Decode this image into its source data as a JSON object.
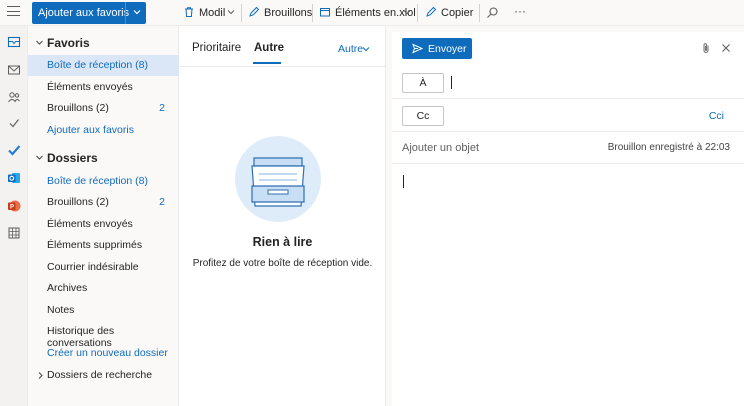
{
  "toolbar": {
    "favorites_button": "Ajouter aux favoris",
    "modify": "Modil",
    "drafts": "Brouillons",
    "sent_items": "Éléments en.xlol",
    "copy": "Copier",
    "more": "···"
  },
  "favorites": {
    "title": "Favoris",
    "items": [
      {
        "label": "Boîte de réception (8)",
        "count": ""
      },
      {
        "label": "Éléments envoyés",
        "count": ""
      },
      {
        "label": "Brouillons (2)",
        "count": "2"
      },
      {
        "label": "Ajouter aux favoris",
        "count": ""
      }
    ]
  },
  "folders": {
    "title": "Dossiers",
    "items": [
      {
        "label": "Boîte de réception (8)",
        "count": ""
      },
      {
        "label": "Brouillons (2)",
        "count": "2"
      },
      {
        "label": "Éléments envoyés",
        "count": ""
      },
      {
        "label": "Éléments supprimés",
        "count": ""
      },
      {
        "label": "Courrier indésirable",
        "count": ""
      },
      {
        "label": "Archives",
        "count": ""
      },
      {
        "label": "Notes",
        "count": ""
      },
      {
        "label": "Historique des conversations",
        "count": ""
      },
      {
        "label": "Créer un nouveau dossier",
        "count": ""
      },
      {
        "label": "Dossiers de recherche",
        "count": ""
      }
    ]
  },
  "message_list": {
    "tabs": [
      "Prioritaire",
      "Autre"
    ],
    "active_tab": "Autre",
    "filter": "Autre",
    "empty_title": "Rien à lire",
    "empty_subtitle": "Profitez de votre boîte de réception vide."
  },
  "compose": {
    "send": "Envoyer",
    "to_label": "À",
    "cc_label": "Cc",
    "bcc_label": "Cci",
    "subject_placeholder": "Ajouter un objet",
    "draft_status": "Brouillon enregistré à 22:03"
  },
  "colors": {
    "accent": "#0f6cbd",
    "selected_bg": "#dbe7f6",
    "empty_circle": "#deecf9"
  },
  "icons": [
    "menu-icon",
    "chevron-down-icon",
    "trash-icon",
    "drafts-icon",
    "folder-move-icon",
    "copy-icon",
    "search-icon",
    "more-icon",
    "mail-icon",
    "people-icon",
    "calendar-icon",
    "todo-icon",
    "outlook-icon",
    "powerpoint-icon",
    "apps-icon",
    "send-icon",
    "attach-icon",
    "close-icon",
    "inbox-tray-icon"
  ]
}
